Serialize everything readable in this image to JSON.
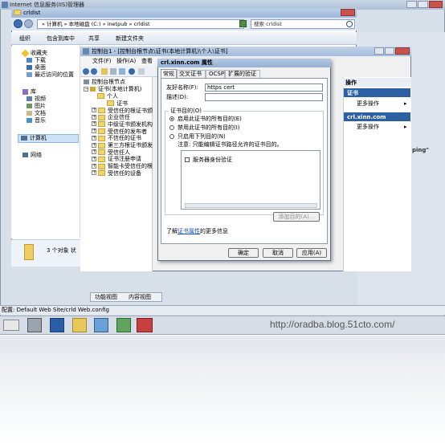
{
  "iis": {
    "title": "Internet 信息服务(IIS)管理器",
    "config_path": "配置: Default Web Site/crld Web.config",
    "tab_feature": "功能视图",
    "tab_content": "内容视图",
    "watermark": "http://oradba.blog.51cto.com/",
    "right_fragment": "ping\""
  },
  "explorer": {
    "title": "crldist",
    "path": "« 计算机 » 本地磁盘 (C:) » inetpub » crldist",
    "search_placeholder": "搜索 crldist",
    "toolbar": {
      "organize": "组织",
      "include": "包含到库中",
      "share": "共享",
      "new_folder": "新建文件夹"
    },
    "nav": {
      "favorites": "收藏夹",
      "downloads": "下载",
      "desktop": "桌面",
      "recent": "最近访问的位置",
      "libraries": "库",
      "videos": "视频",
      "pictures": "图片",
      "documents": "文档",
      "music": "音乐",
      "computer": "计算机",
      "network": "网络"
    },
    "status": "3 个对象  状"
  },
  "mmc": {
    "title": "控制台1 - [控制台根节点\\证书(本地计算机)\\个人\\证书]",
    "menu": {
      "file": "文件(F)",
      "action": "操作(A)",
      "view": "查看"
    },
    "tree": {
      "root": "控制台根节点",
      "certs_local": "证书(本地计算机)",
      "personal": "个人",
      "certificates": "证书",
      "items": [
        "受信任的根证书颁",
        "企业信任",
        "中级证书颁发机构",
        "受信任的发布者",
        "不信任的证书",
        "第三方根证书颁发",
        "受信任人",
        "证书注册申请",
        "智能卡受信任的根",
        "受信任的设备"
      ]
    },
    "actions": {
      "header": "操作",
      "section1": "证书",
      "more1": "更多操作",
      "section2": "crl.xinn.com",
      "more2": "更多操作"
    }
  },
  "dialog": {
    "title": "crl.xinn.com 属性",
    "tabs": [
      "常规",
      "交叉证书",
      "OCSP",
      "扩展的验证"
    ],
    "friendly_label": "友好名称(F):",
    "friendly_value": "https cert",
    "desc_label": "描述(D):",
    "desc_value": "",
    "group_label": "证书目的(O)",
    "radio1": "启用此证书的所有目的(E)",
    "radio2": "禁用此证书的所有目的(I)",
    "radio3": "只启用下列目的(N)",
    "note": "注意: 只能编辑证书路径允许的证书目的。",
    "purpose": "服务器身份验证",
    "add_purpose": "添加目的(A)...",
    "learn_prefix": "了解",
    "learn_link": "证书属性",
    "learn_suffix": "的更多信息",
    "ok": "确定",
    "cancel": "取消",
    "apply": "应用(A)"
  },
  "colors": {
    "titlebar": "#97b4d6",
    "panel_bg": "#e9eef5",
    "accent": "#2d5fa3"
  }
}
